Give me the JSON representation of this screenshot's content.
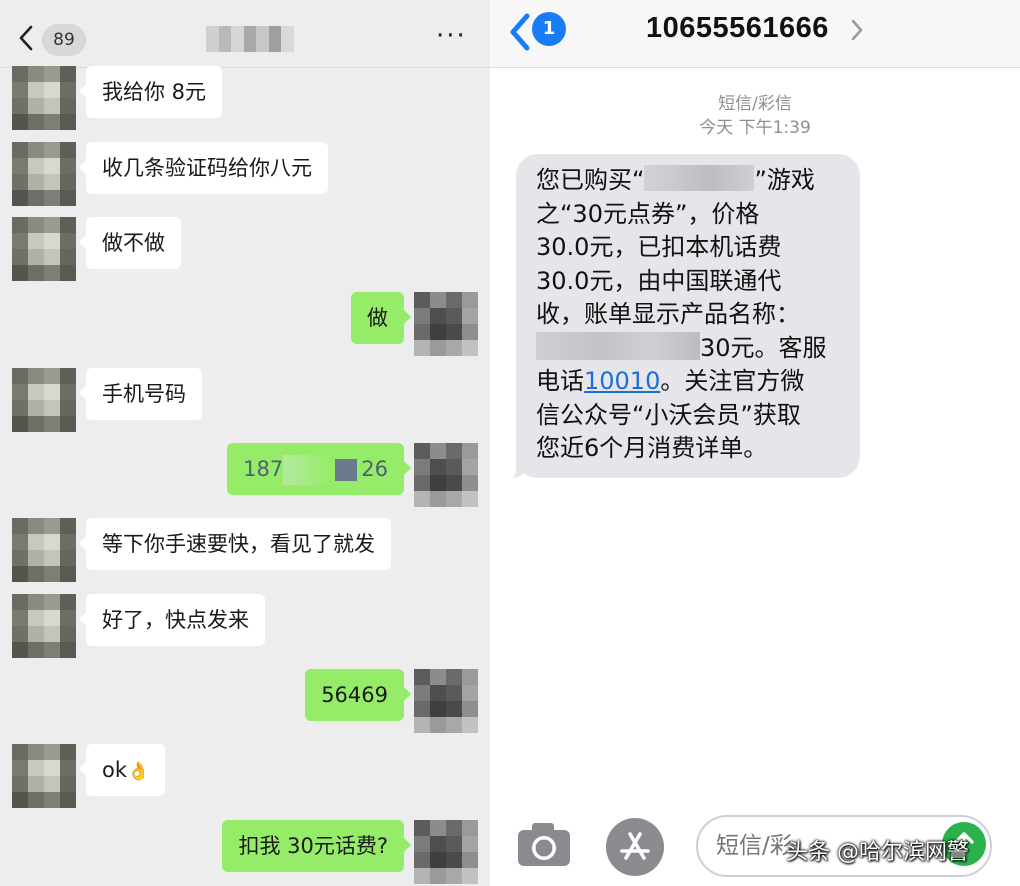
{
  "chat": {
    "back_count": "89",
    "messages": [
      {
        "side": "in",
        "text": "我给你 8元"
      },
      {
        "side": "in",
        "text": "收几条验证码给你八元"
      },
      {
        "side": "in",
        "text": "做不做"
      },
      {
        "side": "out",
        "text": "做"
      },
      {
        "side": "in",
        "text": "手机号码"
      },
      {
        "side": "out",
        "text_start": "187",
        "text_end": "26"
      },
      {
        "side": "in",
        "text": "等下你手速要快，看见了就发"
      },
      {
        "side": "in",
        "text": "好了，快点发来"
      },
      {
        "side": "out",
        "text": "56469"
      },
      {
        "side": "in",
        "text": "ok"
      },
      {
        "side": "out",
        "text": "扣我 30元话费?"
      }
    ]
  },
  "sms": {
    "back_badge": "1",
    "sender": "10655561666",
    "type_label": "短信/彩信",
    "timestamp": "今天 下午1:39",
    "body": {
      "l1_a": "您已购买“",
      "l1_b": "”游戏",
      "l2": "之“30元点券”，价格",
      "l3": "30.0元，已扣本机话费",
      "l4": "30.0元，由中国联通代",
      "l5": "收，账单显示产品名称：",
      "l6_b": "30元。客服",
      "l7_a": "电话",
      "l7_link": "10010",
      "l7_b": "。关注官方微",
      "l8": "信公众号“小沃会员”获取",
      "l9": "您近6个月消费详单。"
    },
    "input_placeholder": "短信/彩",
    "watermark": "头条 @哈尔滨网警",
    "colors": {
      "accent": "#1a7cf5",
      "send": "#2bb24c",
      "bubble_in": "#e5e5ea"
    }
  },
  "icons": [
    "chevron-left-icon",
    "more-icon",
    "camera-icon",
    "app-store-icon",
    "send-icon",
    "ok-hand-emoji"
  ]
}
